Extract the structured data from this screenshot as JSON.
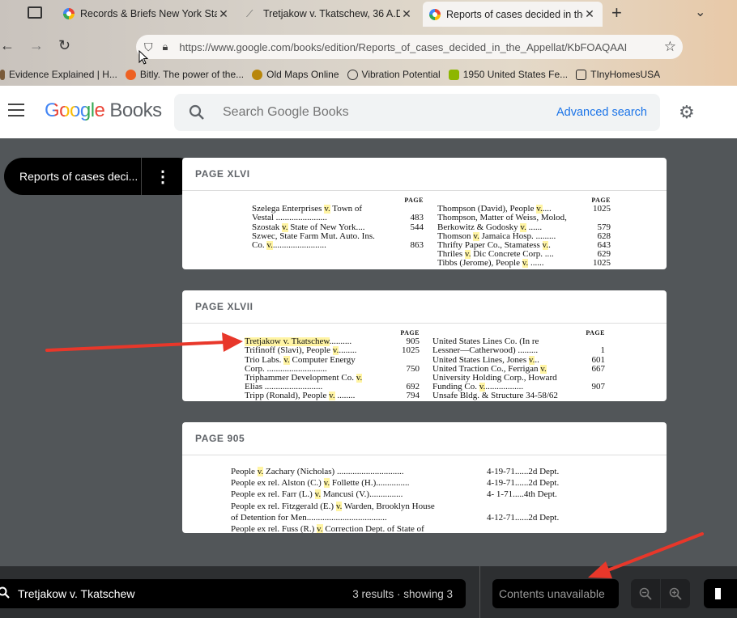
{
  "tabs": [
    {
      "title": "Records & Briefs New York Sta",
      "icon": "google-icon",
      "active": false
    },
    {
      "title": "Tretjakow v. Tkatschew, 36 A.D.",
      "icon": "casetext-icon",
      "active": false
    },
    {
      "title": "Reports of cases decided in the",
      "icon": "google-icon",
      "active": true
    }
  ],
  "tab_close": "✕",
  "new_tab": "+",
  "url": "https://www.google.com/books/edition/Reports_of_cases_decided_in_the_Appellat/KbFOAQAAI",
  "bookmarks": [
    {
      "label": "Evidence Explained | H...",
      "color": "#7a5b3a"
    },
    {
      "label": "Bitly. The power of the...",
      "color": "#ee6123"
    },
    {
      "label": "Old Maps Online",
      "color": "#b8860b"
    },
    {
      "label": "Vibration Potential",
      "color": "#333333"
    },
    {
      "label": "1950 United States Fe...",
      "color": "#8db600"
    },
    {
      "label": "TInyHomesUSA",
      "color": "#222222"
    }
  ],
  "header": {
    "logo_google": "Google",
    "logo_books": "Books",
    "search_placeholder": "Search Google Books",
    "advanced_search": "Advanced search"
  },
  "book_pill": {
    "title": "Reports of cases deci..."
  },
  "results": [
    {
      "page_label": "PAGE XLVI",
      "left_header": "PAGE",
      "right_header": "PAGE",
      "left": [
        {
          "pre": "Szelega Enterprises ",
          "v": "v.",
          "post": " Town of",
          "page": ""
        },
        {
          "pre": "    Vestal .......................",
          "v": "",
          "post": "",
          "page": "483"
        },
        {
          "pre": "Szostak ",
          "v": "v.",
          "post": " State of New York....",
          "page": "544"
        },
        {
          "pre": "Szwec, State Farm Mut. Auto. Ins.",
          "v": "",
          "post": "",
          "page": ""
        },
        {
          "pre": "    Co. ",
          "v": "v.",
          "post": "........................",
          "page": "863"
        }
      ],
      "right": [
        {
          "pre": "Thompson (David), People ",
          "v": "v.",
          "post": "....",
          "page": "1025"
        },
        {
          "pre": "Thompson, Matter of Weiss, Molod,",
          "v": "",
          "post": "",
          "page": ""
        },
        {
          "pre": "    Berkowitz & Godosky ",
          "v": "v.",
          "post": " ......",
          "page": "579"
        },
        {
          "pre": "Thomson ",
          "v": "v.",
          "post": " Jamaica Hosp. .........",
          "page": "628"
        },
        {
          "pre": "Thrifty Paper Co., Stamatess ",
          "v": "v.",
          "post": ".",
          "page": "643"
        },
        {
          "pre": "Thriles ",
          "v": "v.",
          "post": " Dic Concrete Corp. ....",
          "page": "629"
        },
        {
          "pre": "Tibbs (Jerome), People ",
          "v": "v.",
          "post": " ......",
          "page": "1025"
        }
      ]
    },
    {
      "page_label": "PAGE XLVII",
      "left_header": "PAGE",
      "right_header": "PAGE",
      "left": [
        {
          "pre": "",
          "v": "Tretjakow v. Tkatschew",
          "post": "..........",
          "page": "905"
        },
        {
          "pre": "Trifinoff (Slavi), People ",
          "v": "v.",
          "post": "........",
          "page": "1025"
        },
        {
          "pre": "Trio Labs. ",
          "v": "v.",
          "post": " Computer Energy",
          "page": ""
        },
        {
          "pre": "    Corp. ...........................",
          "v": "",
          "post": "",
          "page": "750"
        },
        {
          "pre": "Triphammer Development Co. ",
          "v": "v.",
          "post": "",
          "page": ""
        },
        {
          "pre": "    Elias ..........................",
          "v": "",
          "post": "",
          "page": "692"
        },
        {
          "pre": "Tripp (Ronald), People ",
          "v": "v.",
          "post": " ........",
          "page": "794"
        }
      ],
      "right": [
        {
          "pre": "United States Lines Co. (In re",
          "v": "",
          "post": "",
          "page": ""
        },
        {
          "pre": "    Lessner—Catherwood) .........",
          "v": "",
          "post": "",
          "page": "1"
        },
        {
          "pre": "United States Lines, Jones ",
          "v": "v.",
          "post": "..",
          "page": "601"
        },
        {
          "pre": "United Traction Co., Ferrigan ",
          "v": "v.",
          "post": "",
          "page": "667"
        },
        {
          "pre": "University Holding Corp., Howard",
          "v": "",
          "post": "",
          "page": ""
        },
        {
          "pre": "    Funding Co. ",
          "v": "v.",
          "post": ".................",
          "page": "907"
        },
        {
          "pre": "Unsafe Bldg. & Structure 34-58/62",
          "v": "",
          "post": "",
          "page": ""
        }
      ]
    },
    {
      "page_label": "PAGE 905",
      "left_header": "",
      "right_header": "",
      "rows": [
        {
          "pre": "People ",
          "v": "v.",
          "post": " Zachary (Nicholas) ..............................",
          "date": "4-19-71......2d Dept."
        },
        {
          "pre": "People ex rel. Alston (C.) ",
          "v": "v.",
          "post": " Follette (H.)...............",
          "date": "4-19-71......2d Dept."
        },
        {
          "pre": "People ex rel. Farr (L.) ",
          "v": "v.",
          "post": " Mancusi (V.)...............",
          "date": "4- 1-71.....4th Dept."
        },
        {
          "pre": "People ex rel. Fitzgerald (E.) ",
          "v": "v.",
          "post": " Warden, Brooklyn House",
          "date": ""
        },
        {
          "pre": "    of Detention for Men....................................",
          "v": "",
          "post": "",
          "date": "4-12-71......2d Dept."
        },
        {
          "pre": "People ex rel. Fuss (R.) ",
          "v": "v.",
          "post": " Correction Dept. of State of",
          "date": ""
        }
      ]
    }
  ],
  "bottom": {
    "query": "Tretjakow v. Tkatschew",
    "result_count": "3 results · showing 3",
    "contents": "Contents unavailable",
    "zoom_out": "−",
    "zoom_in": "+"
  }
}
